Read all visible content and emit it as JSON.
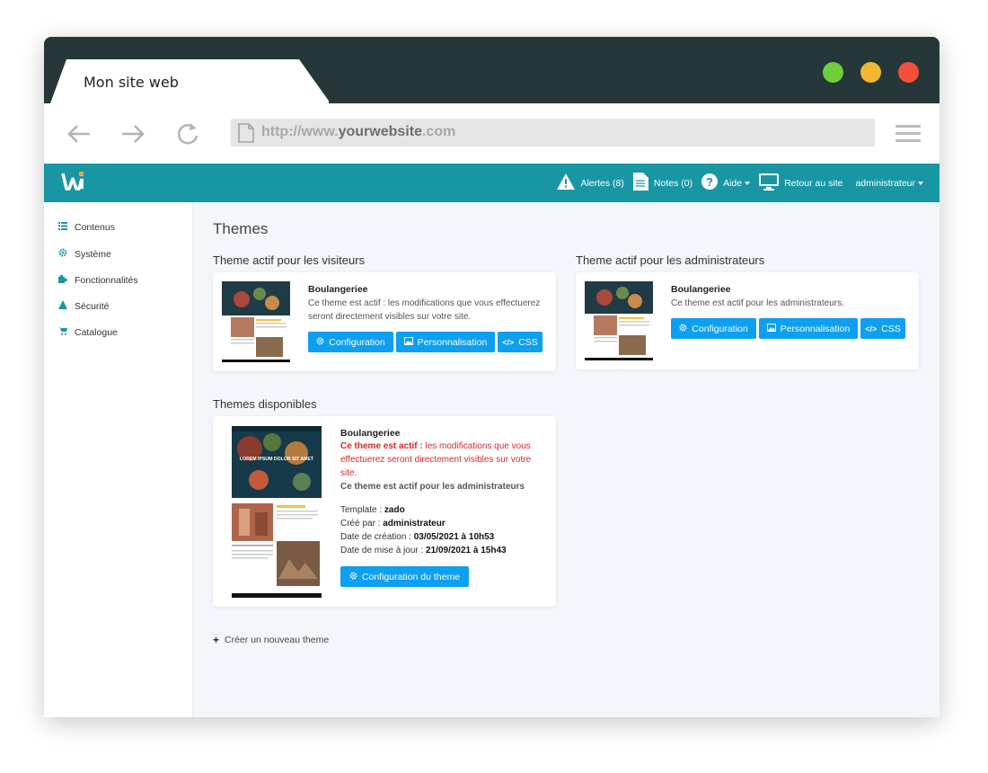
{
  "browser": {
    "tab_title": "Mon site web",
    "url_prefix": "http://www.",
    "url_domain": "yourwebsite",
    "url_suffix": ".com"
  },
  "topnav": {
    "alerts": "Alertes (8)",
    "notes": "Notes (0)",
    "help": "Aide",
    "back_to_site": "Retour au site",
    "user": "administrateur"
  },
  "sidebar": {
    "items": [
      {
        "label": "Contenus",
        "icon": "list-icon"
      },
      {
        "label": "Système",
        "icon": "gear-icon"
      },
      {
        "label": "Fonctionnalités",
        "icon": "puzzle-icon"
      },
      {
        "label": "Sécurité",
        "icon": "warning-icon"
      },
      {
        "label": "Catalogue",
        "icon": "cart-icon"
      }
    ]
  },
  "main": {
    "title": "Themes",
    "visitors_heading": "Theme actif pour les visiteurs",
    "admins_heading": "Theme actif pour les administrateurs",
    "available_heading": "Themes disponibles",
    "visitor_card": {
      "name": "Boulangeriee",
      "desc": "Ce theme est actif : les modifications que vous effectuerez seront directement visibles sur votre site."
    },
    "admin_card": {
      "name": "Boulangeriee",
      "desc": "Ce theme est actif pour les administrateurs."
    },
    "buttons": {
      "configuration": "Configuration",
      "personnalisation": "Personnalisation",
      "css": "CSS"
    },
    "available_card": {
      "name": "Boulangeriee",
      "active_bold": "Ce theme est actif :",
      "active_rest": " les modifications que vous effectuerez seront directement visibles sur votre site.",
      "admin_active": "Ce theme est actif pour les administrateurs",
      "template_label": "Template : ",
      "template_value": "zado",
      "created_by_label": "Créé par : ",
      "created_by_value": "administrateur",
      "created_date_label": "Date de création : ",
      "created_date_value": "03/05/2021 à 10h53",
      "updated_label": "Date de mise à jour : ",
      "updated_value": "21/09/2021 à 15h43",
      "config_button": "Configuration du theme",
      "thumb_headline": "LOREM IPSUM DOLOR SIT AMET"
    },
    "create_link": "Créer un nouveau theme"
  },
  "colors": {
    "titlebar": "#253739",
    "appbar": "#1896a3",
    "button": "#0d9ff0",
    "alert_red": "#d9262e"
  }
}
